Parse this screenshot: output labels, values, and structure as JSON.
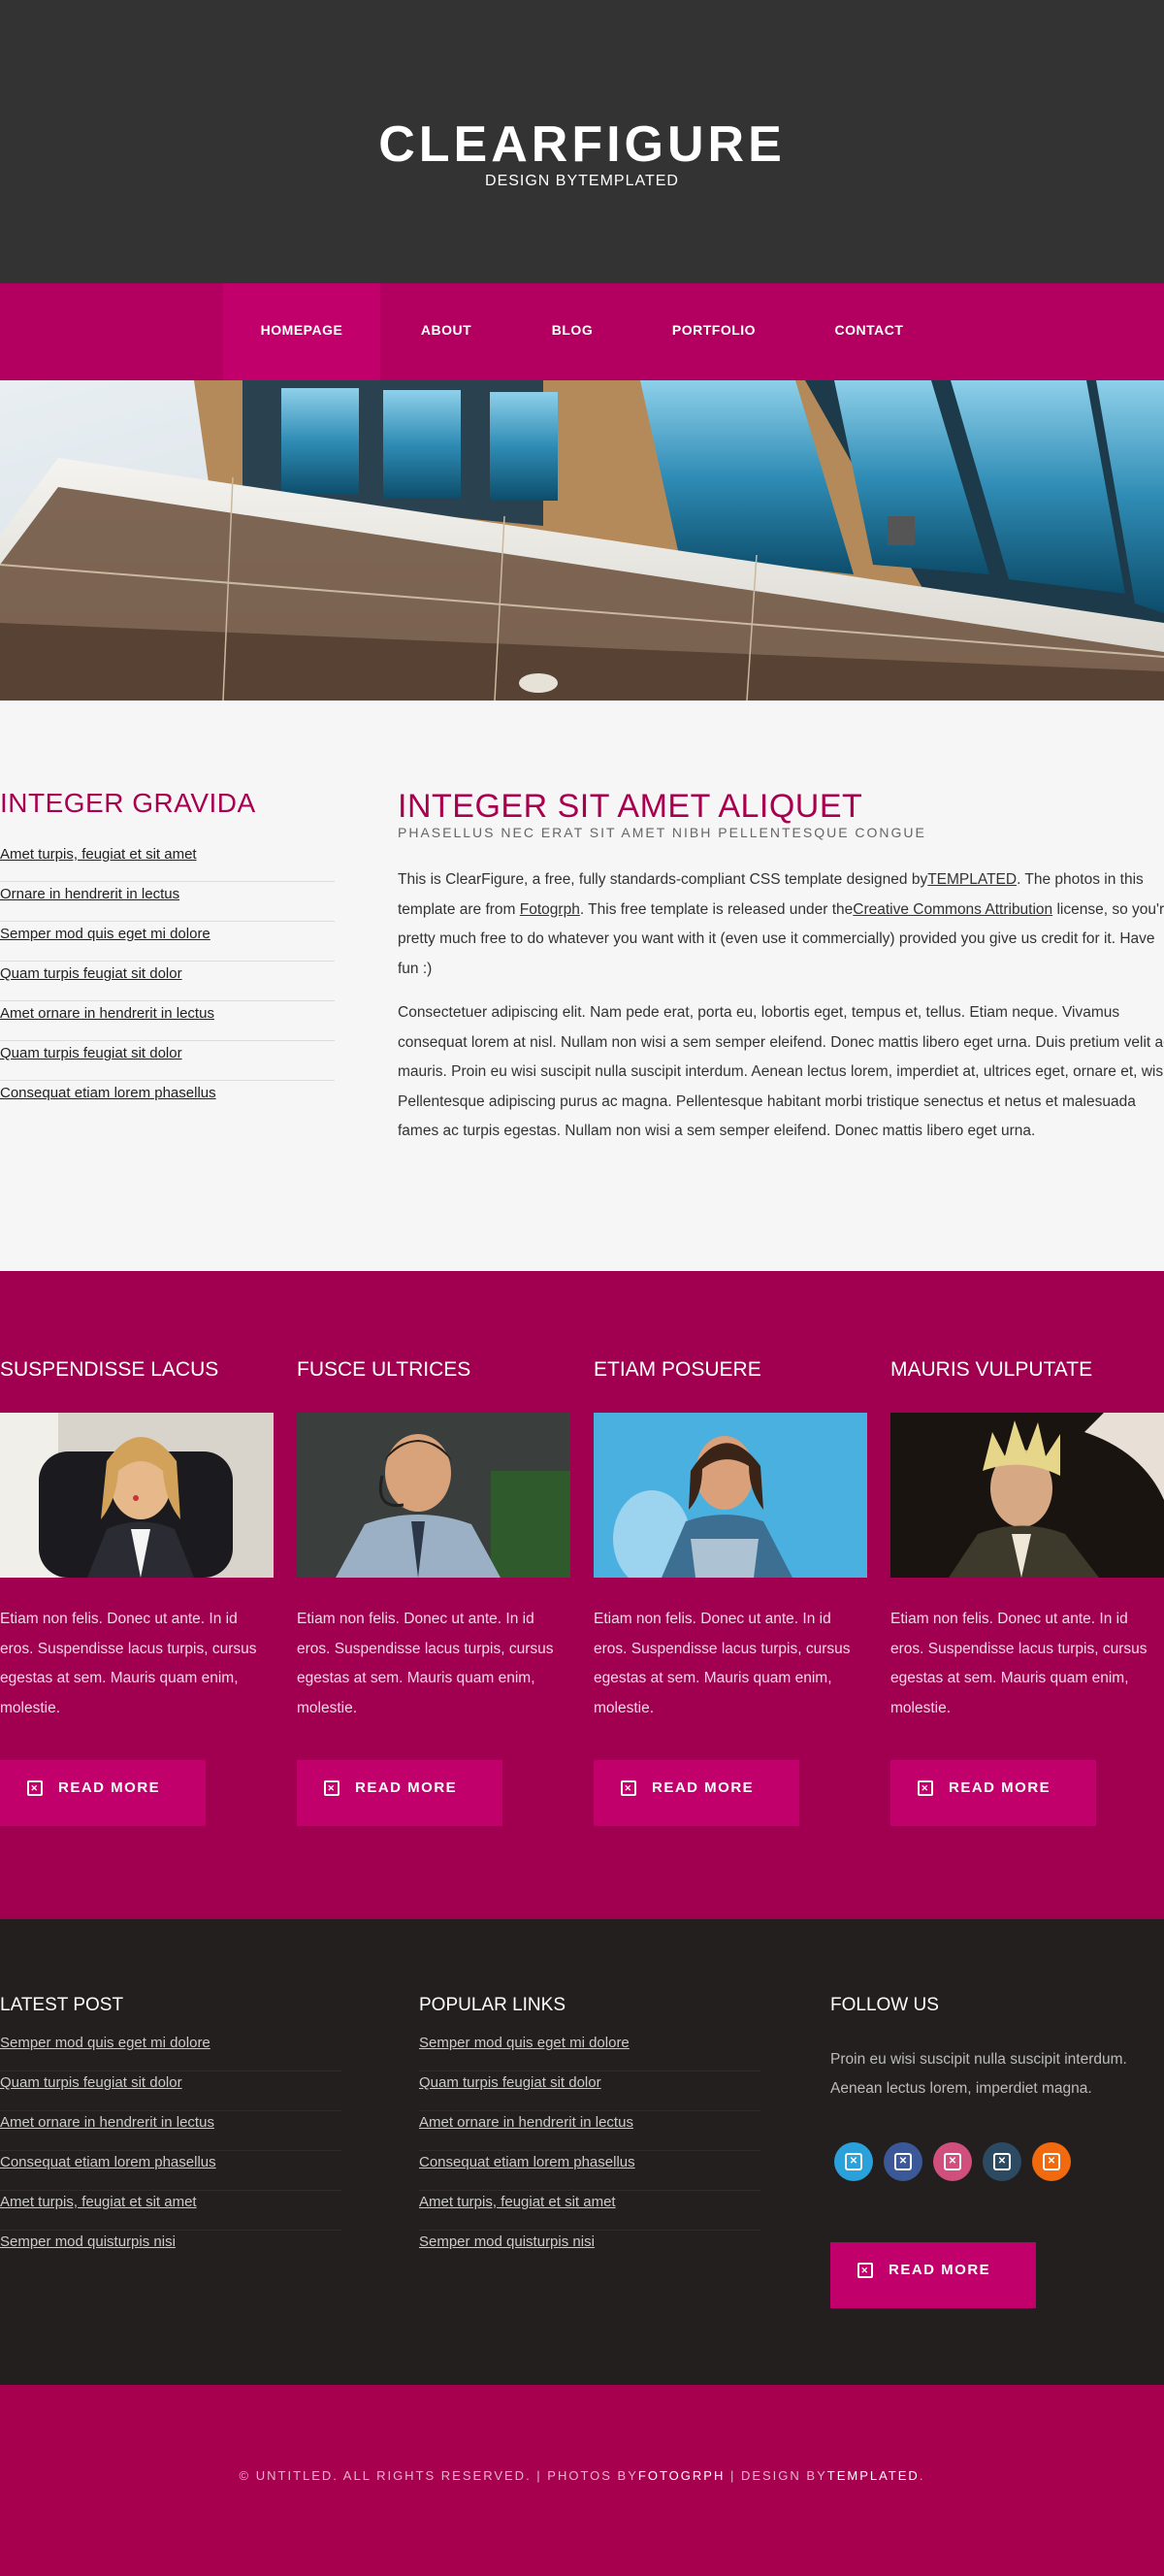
{
  "header": {
    "logo": "CLEARFIGURE",
    "subtitle": "DESIGN BYTEMPLATED"
  },
  "nav": {
    "items": [
      "HOMEPAGE",
      "ABOUT",
      "BLOG",
      "PORTFOLIO",
      "CONTACT"
    ],
    "active": "HOMEPAGE"
  },
  "sidebar": {
    "title": "INTEGER GRAVIDA",
    "links": [
      "Amet turpis, feugiat et sit amet",
      "Ornare in hendrerit in lectus",
      "Semper mod quis eget mi dolore",
      "Quam turpis feugiat sit dolor",
      "Amet ornare in hendrerit in lectus",
      "Quam turpis feugiat sit dolor",
      "Consequat etiam lorem phasellus"
    ]
  },
  "content": {
    "title": "INTEGER SIT AMET ALIQUET",
    "subtitle": "PHASELLUS NEC ERAT SIT AMET NIBH PELLENTESQUE CONGUE",
    "p1_a": "This is ClearFigure, a free, fully standards-compliant CSS template designed by",
    "p1_link1": "TEMPLATED",
    "p1_b": ". The photos in this template are from ",
    "p1_link2": "Fotogrph",
    "p1_c": ". This free template is released under the",
    "p1_link3": "Creative Commons Attribution",
    "p1_d": " license, so you're pretty much free to do whatever you want with it (even use it commercially) provided you give us credit for it. Have fun :)",
    "p2": "Consectetuer adipiscing elit. Nam pede erat, porta eu, lobortis eget, tempus et, tellus. Etiam neque. Vivamus consequat lorem at nisl. Nullam non wisi a sem semper eleifend. Donec mattis libero eget urna. Duis pretium velit ac mauris. Proin eu wisi suscipit nulla suscipit interdum. Aenean lectus lorem, imperdiet at, ultrices eget, ornare et, wisi. Pellentesque adipiscing purus ac magna. Pellentesque habitant morbi tristique senectus et netus et malesuada fames ac turpis egestas. Nullam non wisi a sem semper eleifend. Donec mattis libero eget urna."
  },
  "features": [
    {
      "title": "SUSPENDISSE LACUS",
      "text": "Etiam non felis. Donec ut ante. In id eros. Suspendisse lacus turpis, cursus egestas at sem. Mauris quam enim, molestie.",
      "button": "READ MORE"
    },
    {
      "title": "FUSCE ULTRICES",
      "text": "Etiam non felis. Donec ut ante. In id eros. Suspendisse lacus turpis, cursus egestas at sem. Mauris quam enim, molestie.",
      "button": "READ MORE"
    },
    {
      "title": "ETIAM POSUERE",
      "text": "Etiam non felis. Donec ut ante. In id eros. Suspendisse lacus turpis, cursus egestas at sem. Mauris quam enim, molestie.",
      "button": "READ MORE"
    },
    {
      "title": "MAURIS VULPUTATE",
      "text": "Etiam non felis. Donec ut ante. In id eros. Suspendisse lacus turpis, cursus egestas at sem. Mauris quam enim, molestie.",
      "button": "READ MORE"
    }
  ],
  "footer": {
    "latest": {
      "title": "LATEST POST",
      "links": [
        "Semper mod quis eget mi dolore",
        "Quam turpis feugiat sit dolor",
        "Amet ornare in hendrerit in lectus",
        "Consequat etiam lorem phasellus",
        "Amet turpis, feugiat et sit amet",
        "Semper mod quisturpis nisi"
      ]
    },
    "popular": {
      "title": "POPULAR LINKS",
      "links": [
        "Semper mod quis eget mi dolore",
        "Quam turpis feugiat sit dolor",
        "Amet ornare in hendrerit in lectus",
        "Consequat etiam lorem phasellus",
        "Amet turpis, feugiat et sit amet",
        "Semper mod quisturpis nisi"
      ]
    },
    "follow": {
      "title": "FOLLOW US",
      "text": "Proin eu wisi suscipit nulla suscipit interdum. Aenean lectus lorem, imperdiet magna.",
      "button": "READ MORE",
      "social": [
        {
          "icon": "twitter-icon",
          "color": "#2aa1db"
        },
        {
          "icon": "facebook-icon",
          "color": "#3b5998"
        },
        {
          "icon": "dribbble-icon",
          "color": "#d14f7d"
        },
        {
          "icon": "linkedin-icon",
          "color": "#2d4a63"
        },
        {
          "icon": "rss-icon",
          "color": "#f26a0f"
        }
      ]
    }
  },
  "copyright": {
    "a": "© UNTITLED. ALL RIGHTS RESERVED. | PHOTOS BY",
    "b": "FOTOGRPH",
    "c": " | DESIGN BY",
    "d": "TEMPLATED",
    "e": "."
  },
  "colors": {
    "accent": "#a8004f",
    "nav": "#b30060",
    "header": "#333333",
    "footer": "#221f1e"
  }
}
